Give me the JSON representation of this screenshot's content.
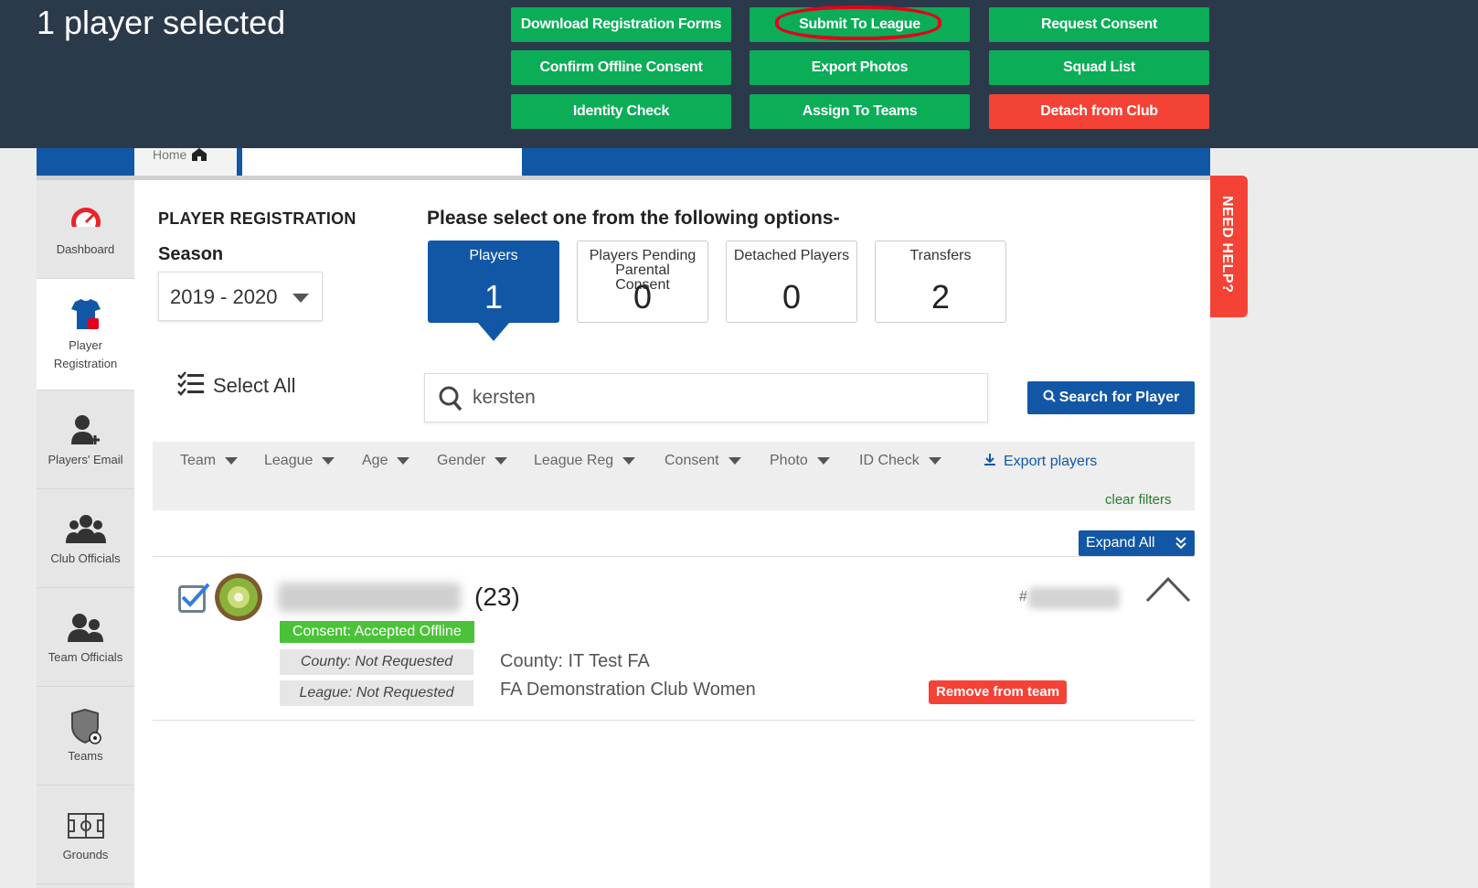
{
  "selection_bar": {
    "count_text": "1 player selected",
    "actions": [
      {
        "label": "Download Registration Forms"
      },
      {
        "label": "Submit To League"
      },
      {
        "label": "Request Consent"
      },
      {
        "label": "Confirm Offline Consent"
      },
      {
        "label": "Export Photos"
      },
      {
        "label": "Squad List"
      },
      {
        "label": "Identity Check"
      },
      {
        "label": "Assign To Teams"
      },
      {
        "label": "Detach from Club"
      }
    ]
  },
  "breadcrumb": {
    "home_label": "Home"
  },
  "sidebar": {
    "items": [
      {
        "label": "Dashboard"
      },
      {
        "label": "Player Registration"
      },
      {
        "label": "Players' Email"
      },
      {
        "label": "Club Officials"
      },
      {
        "label": "Team Officials"
      },
      {
        "label": "Teams"
      },
      {
        "label": "Grounds"
      }
    ]
  },
  "page": {
    "section_title": "PLAYER REGISTRATION",
    "season_label": "Season",
    "season_value": "2019 - 2020",
    "options_title": "Please select one from the following options-",
    "options": [
      {
        "label": "Players",
        "count": "1"
      },
      {
        "label": "Players Pending Parental Consent",
        "count": "0"
      },
      {
        "label": "Detached Players",
        "count": "0"
      },
      {
        "label": "Transfers",
        "count": "2"
      }
    ],
    "select_all_label": "Select All",
    "search_value": "kersten",
    "search_button_label": "Search for Player",
    "filters": [
      {
        "label": "Team"
      },
      {
        "label": "League"
      },
      {
        "label": "Age"
      },
      {
        "label": "Gender"
      },
      {
        "label": "League Reg"
      },
      {
        "label": "Consent"
      },
      {
        "label": "Photo"
      },
      {
        "label": "ID Check"
      }
    ],
    "export_label": "Export players",
    "clear_filters_label": "clear filters",
    "expand_all_label": "Expand All"
  },
  "player": {
    "age_text": "(23)",
    "id_prefix": "#",
    "consent_badge": "Consent: Accepted Offline",
    "county_status": "County: Not Requested",
    "league_status": "League: Not Requested",
    "county_info": "County: IT Test FA",
    "club_info": "FA Demonstration Club Women",
    "remove_label": "Remove from team"
  },
  "need_help_label": "NEED HELP?",
  "colors": {
    "topbar": "#2b3a4a",
    "action_green": "#0bad57",
    "danger_red": "#f44336",
    "brand_blue": "#1157a6",
    "consent_green": "#4cc23a"
  }
}
